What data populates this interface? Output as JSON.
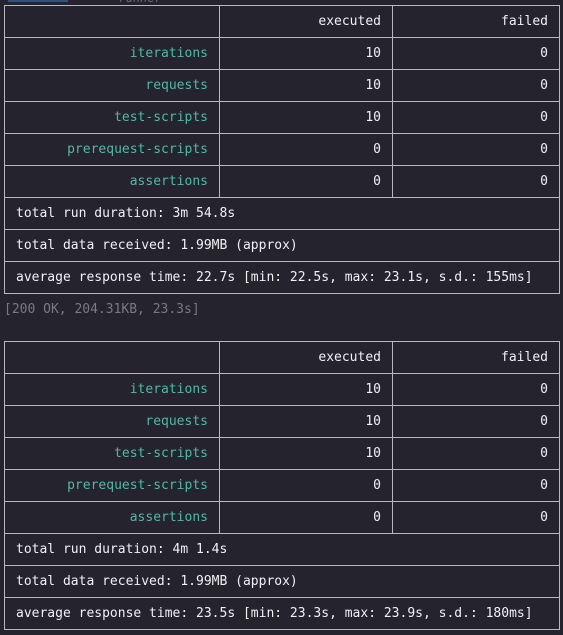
{
  "top_ghost_text": "runner",
  "tables": [
    {
      "headers": {
        "executed": "executed",
        "failed": "failed"
      },
      "rows": [
        {
          "label": "iterations",
          "executed": "10",
          "failed": "0"
        },
        {
          "label": "requests",
          "executed": "10",
          "failed": "0"
        },
        {
          "label": "test-scripts",
          "executed": "10",
          "failed": "0"
        },
        {
          "label": "prerequest-scripts",
          "executed": "0",
          "failed": "0"
        },
        {
          "label": "assertions",
          "executed": "0",
          "failed": "0"
        }
      ],
      "total_run_duration": "total run duration: 3m 54.8s",
      "total_data_received": "total data received: 1.99MB (approx)",
      "average_response_time": "average response time: 22.7s [min: 22.5s, max: 23.1s, s.d.: 155ms]"
    },
    {
      "headers": {
        "executed": "executed",
        "failed": "failed"
      },
      "rows": [
        {
          "label": "iterations",
          "executed": "10",
          "failed": "0"
        },
        {
          "label": "requests",
          "executed": "10",
          "failed": "0"
        },
        {
          "label": "test-scripts",
          "executed": "10",
          "failed": "0"
        },
        {
          "label": "prerequest-scripts",
          "executed": "0",
          "failed": "0"
        },
        {
          "label": "assertions",
          "executed": "0",
          "failed": "0"
        }
      ],
      "total_run_duration": "total run duration: 4m 1.4s",
      "total_data_received": "total data received: 1.99MB (approx)",
      "average_response_time": "average response time: 23.5s [min: 23.3s, max: 23.9s, s.d.: 180ms]"
    }
  ],
  "status_line": "[200 OK, 204.31KB, 23.3s]",
  "colors": {
    "background": "#24232e",
    "label": "#52b8a6",
    "text": "#f1f1f3",
    "border": "#b8b8c0",
    "muted": "#7a7985"
  }
}
